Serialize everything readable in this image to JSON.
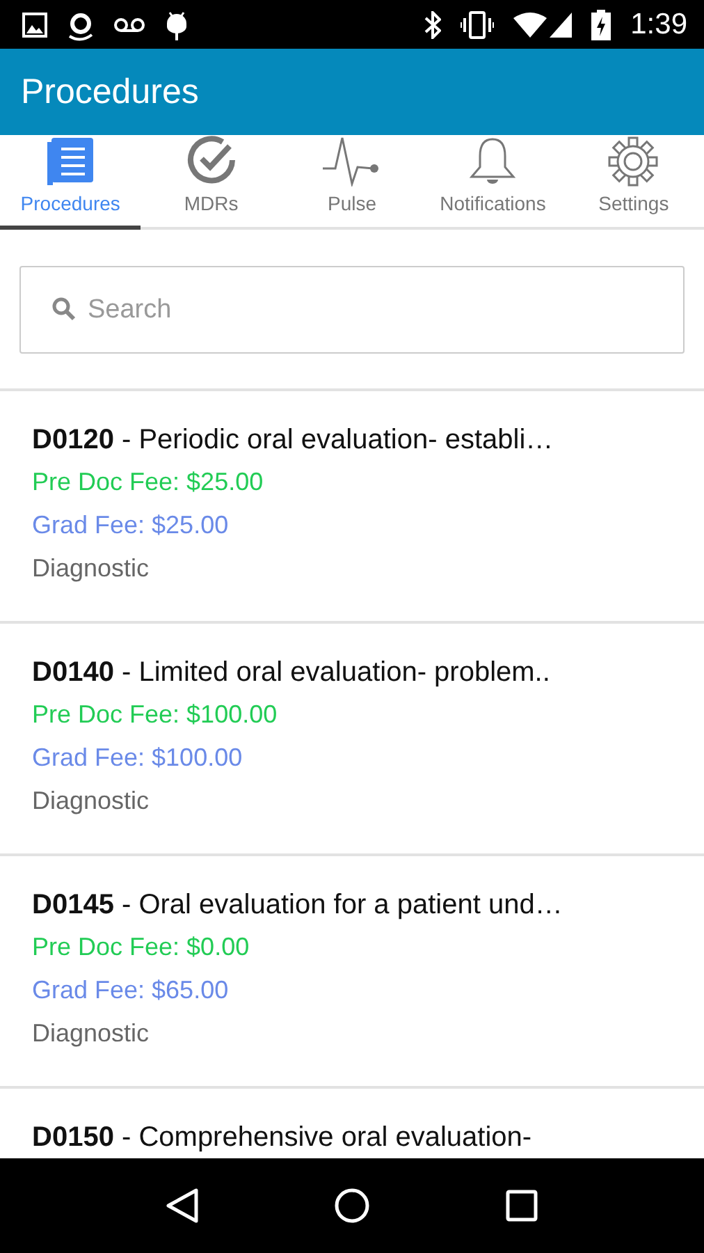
{
  "status_bar": {
    "time": "1:39"
  },
  "app_bar": {
    "title": "Procedures"
  },
  "tabs": [
    {
      "label": "Procedures",
      "kind": "list",
      "selected": true
    },
    {
      "label": "MDRs",
      "kind": "check",
      "selected": false
    },
    {
      "label": "Pulse",
      "kind": "pulse",
      "selected": false
    },
    {
      "label": "Notifications",
      "kind": "bell",
      "selected": false
    },
    {
      "label": "Settings",
      "kind": "gear",
      "selected": false
    }
  ],
  "search": {
    "placeholder": "Search"
  },
  "procedures": [
    {
      "heading": "**D0120** - Periodic oral evaluation- establi…",
      "pre_doc_fee": "Pre Doc Fee: $25.00",
      "grad_fee": "Grad Fee: $25.00",
      "category": "Diagnostic"
    },
    {
      "heading": "**D0140** - Limited oral evaluation- problem..",
      "pre_doc_fee": "Pre Doc Fee: $100.00",
      "grad_fee": "Grad Fee: $100.00",
      "category": "Diagnostic"
    },
    {
      "heading": "**D0145** - Oral evaluation for a patient und…",
      "pre_doc_fee": "Pre Doc Fee: $0.00",
      "grad_fee": "Grad Fee: $65.00",
      "category": "Diagnostic"
    },
    {
      "heading": "**D0150** - Comprehensive oral evaluation-"
    }
  ]
}
